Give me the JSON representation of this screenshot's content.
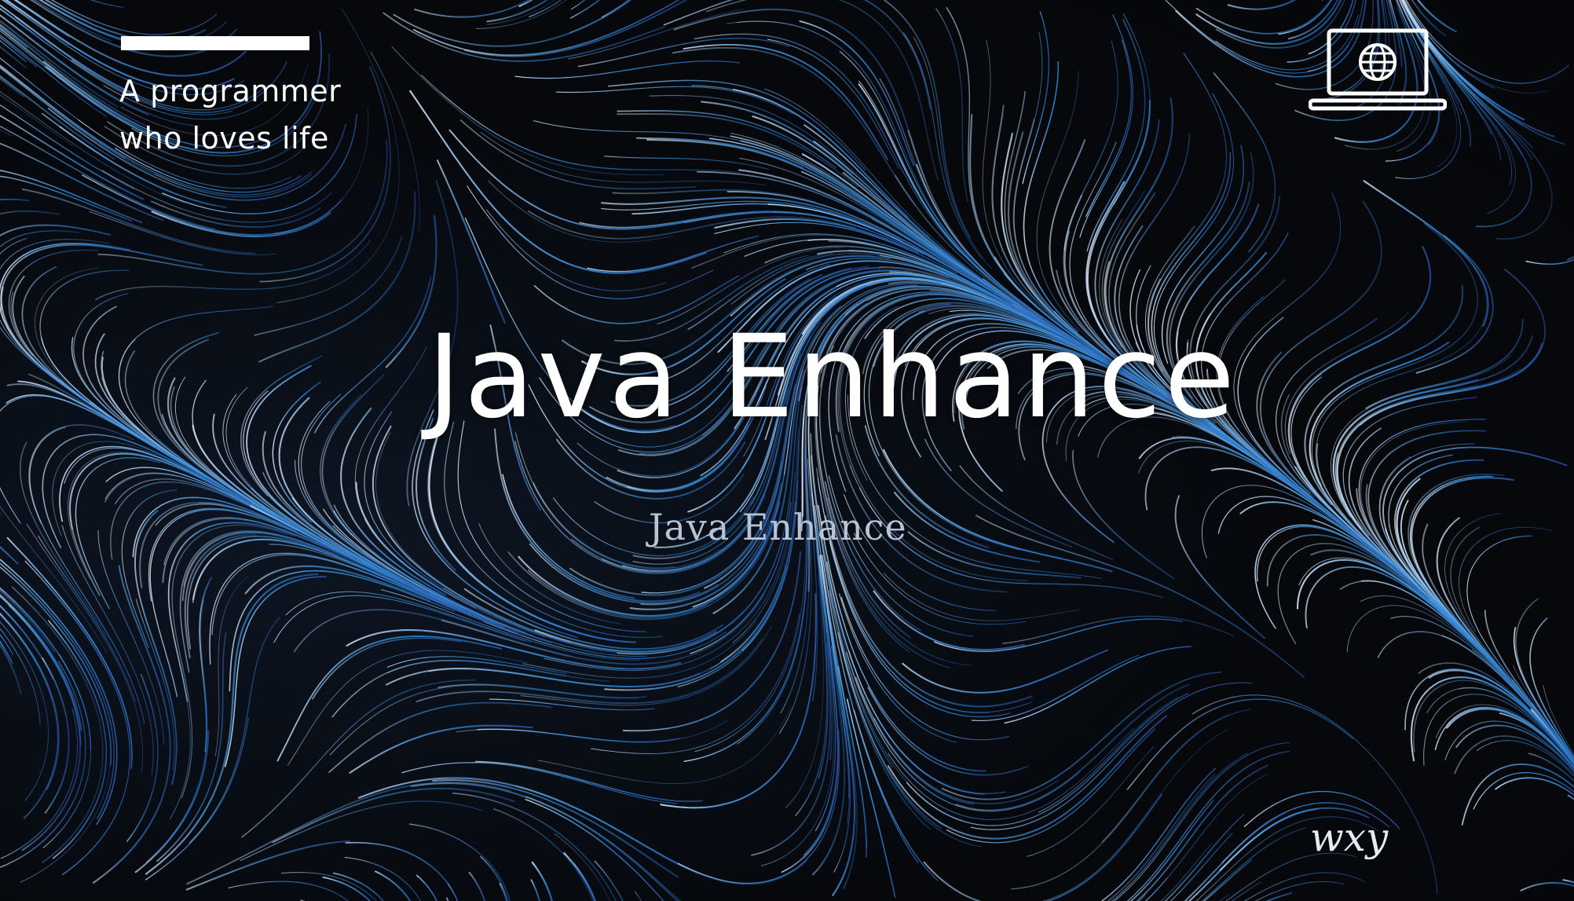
{
  "slide": {
    "tagline": {
      "line1": "A programmer",
      "line2": "who loves life"
    },
    "title": "Java Enhance",
    "subtitle": "Java Enhance",
    "signature": "wxy",
    "icon": "laptop-globe-icon"
  },
  "colors": {
    "background": "#07090d",
    "flow_light": "#cfe3f7",
    "flow_mid": "#3c8ad8",
    "flow_deep": "#2a5aa8",
    "text": "#ffffff",
    "subtitle": "#b8c4d6"
  }
}
